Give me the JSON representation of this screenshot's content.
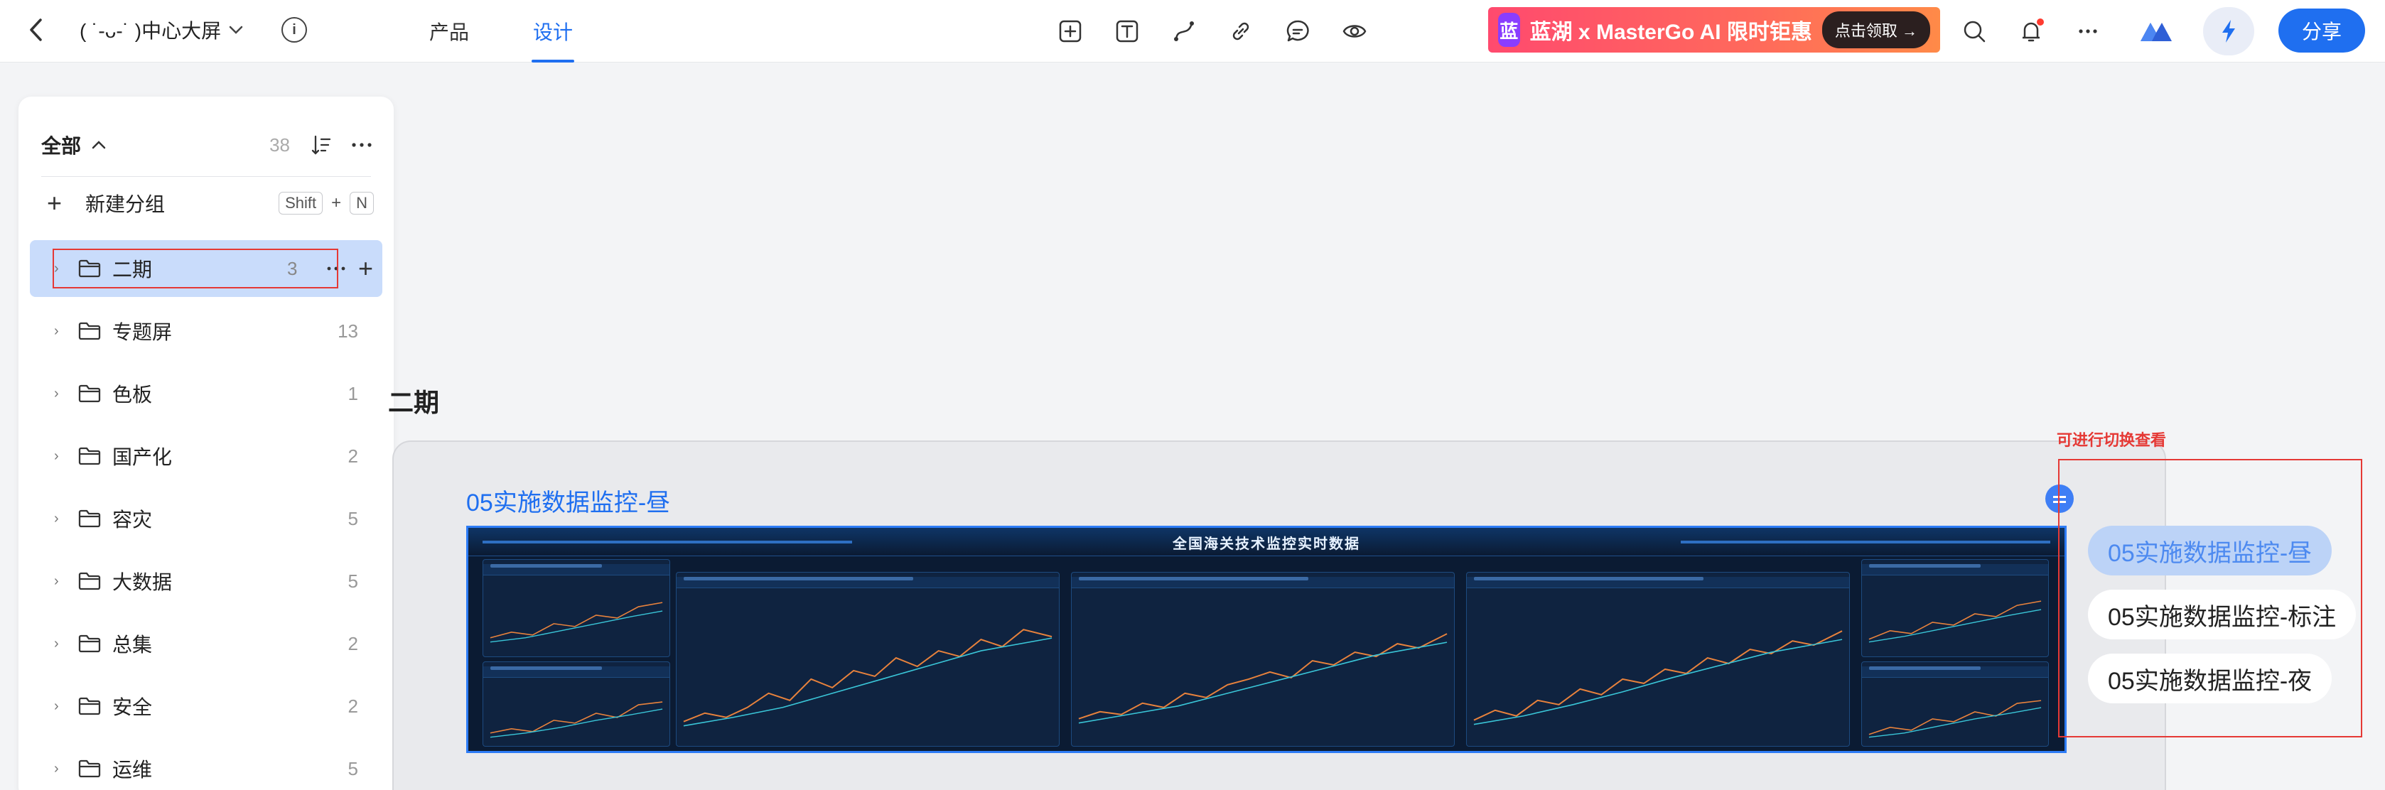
{
  "topbar": {
    "project_title": "( ˙-ᴗ-˙ )中心大屏",
    "tabs": [
      {
        "label": "产品",
        "active": false
      },
      {
        "label": "设计",
        "active": true
      }
    ],
    "tools": [
      "frame-tool-icon",
      "text-tool-icon",
      "path-tool-icon",
      "link-icon",
      "comment-icon",
      "preview-eye-icon"
    ],
    "promo": {
      "logo": "蓝",
      "text": "蓝湖 x MasterGo AI 限时钜惠",
      "cta": "点击领取 →"
    },
    "share_label": "分享",
    "accent_color": "#1f6ff0"
  },
  "sidebar": {
    "header": {
      "label": "全部",
      "count": "38"
    },
    "new_group": {
      "label": "新建分组",
      "shortcut_keys": [
        "Shift",
        "+",
        "N"
      ]
    },
    "items": [
      {
        "label": "二期",
        "count": "3",
        "active": true
      },
      {
        "label": "专题屏",
        "count": "13"
      },
      {
        "label": "色板",
        "count": "1"
      },
      {
        "label": "国产化",
        "count": "2"
      },
      {
        "label": "容灾",
        "count": "5"
      },
      {
        "label": "大数据",
        "count": "5"
      },
      {
        "label": "总集",
        "count": "2"
      },
      {
        "label": "安全",
        "count": "2"
      },
      {
        "label": "运维",
        "count": "5"
      }
    ]
  },
  "canvas": {
    "section_title": "二期",
    "frame_name": "05实施数据监控-昼",
    "dashboard_title": "全国海关技术监控实时数据",
    "switch_hint": "可进行切换查看",
    "switch_items": [
      {
        "label": "05实施数据监控-昼",
        "selected": true
      },
      {
        "label": "05实施数据监控-标注",
        "selected": false
      },
      {
        "label": "05实施数据监控-夜",
        "selected": false
      }
    ]
  }
}
